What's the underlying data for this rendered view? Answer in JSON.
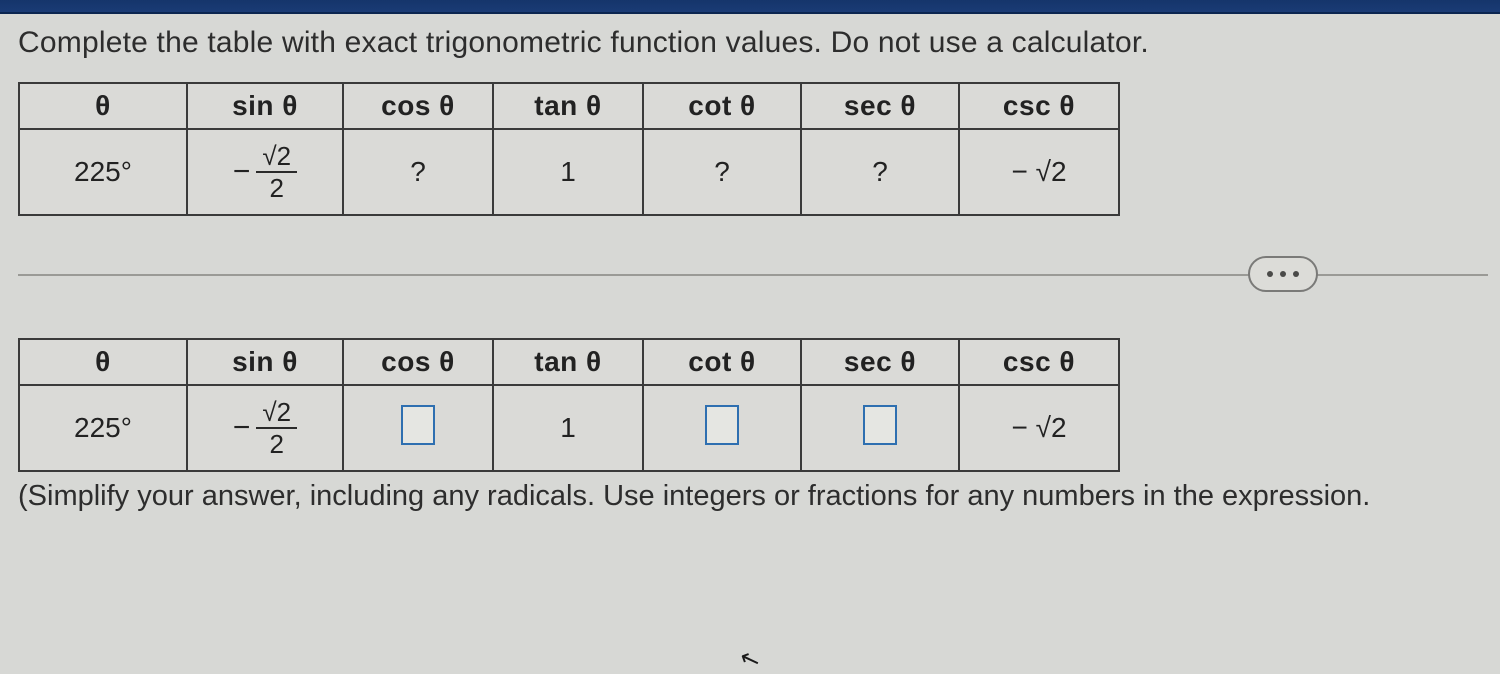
{
  "prompt": "Complete the table with exact trigonometric function values. Do not use a calculator.",
  "headers": {
    "theta": "θ",
    "sin": "sin θ",
    "cos": "cos θ",
    "tan": "tan θ",
    "cot": "cot θ",
    "sec": "sec θ",
    "csc": "csc θ"
  },
  "table1": {
    "angle": "225°",
    "sin_sign": "−",
    "sin_num": "√2",
    "sin_den": "2",
    "cos": "?",
    "tan": "1",
    "cot": "?",
    "sec": "?",
    "csc": "− √2"
  },
  "table2": {
    "angle": "225°",
    "sin_sign": "−",
    "sin_num": "√2",
    "sin_den": "2",
    "tan": "1",
    "csc": "− √2"
  },
  "hint": "(Simplify your answer, including any radicals. Use integers or fractions for any numbers in the expression.",
  "chart_data": [
    {
      "type": "table",
      "title": "Trigonometric function values (question)",
      "columns": [
        "θ",
        "sin θ",
        "cos θ",
        "tan θ",
        "cot θ",
        "sec θ",
        "csc θ"
      ],
      "rows": [
        [
          "225°",
          "−√2/2",
          "?",
          "1",
          "?",
          "?",
          "−√2"
        ]
      ]
    },
    {
      "type": "table",
      "title": "Trigonometric function values (answer entry)",
      "columns": [
        "θ",
        "sin θ",
        "cos θ",
        "tan θ",
        "cot θ",
        "sec θ",
        "csc θ"
      ],
      "rows": [
        [
          "225°",
          "−√2/2",
          "[input]",
          "1",
          "[input]",
          "[input]",
          "−√2"
        ]
      ]
    }
  ]
}
